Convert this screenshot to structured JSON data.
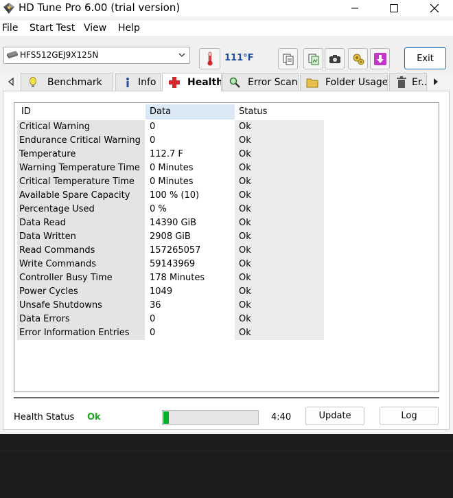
{
  "window": {
    "title": "HD Tune Pro 6.00 (trial version)",
    "controls": {
      "minimize": "minimize-icon",
      "maximize": "maximize-icon",
      "close": "close-icon"
    }
  },
  "menu": [
    "File",
    "Start Test",
    "View",
    "Help"
  ],
  "toolbar": {
    "drive": "HFS512GEJ9X125N",
    "temperature": "111°F",
    "icons": [
      "thermometer-icon",
      "copy-info-icon",
      "copy-screenshot-icon",
      "camera-icon",
      "options-icon",
      "save-icon"
    ],
    "exit_label": "Exit"
  },
  "tabs": [
    {
      "label": "Benchmark",
      "icon": "benchmark-icon"
    },
    {
      "label": "Info",
      "icon": "info-icon"
    },
    {
      "label": "Health",
      "icon": "health-icon",
      "active": true
    },
    {
      "label": "Error Scan",
      "icon": "error-scan-icon"
    },
    {
      "label": "Folder Usage",
      "icon": "folder-usage-icon"
    },
    {
      "label": "Er...",
      "icon": "erase-icon"
    }
  ],
  "table": {
    "columns": [
      "ID",
      "Data",
      "Status"
    ],
    "rows": [
      {
        "id": "Critical Warning",
        "data": "0",
        "status": "Ok"
      },
      {
        "id": "Endurance Critical Warning",
        "data": "0",
        "status": "Ok"
      },
      {
        "id": "Temperature",
        "data": "112.7 F",
        "status": "Ok"
      },
      {
        "id": "Warning Temperature Time",
        "data": "0 Minutes",
        "status": "Ok"
      },
      {
        "id": "Critical Temperature Time",
        "data": "0 Minutes",
        "status": "Ok"
      },
      {
        "id": "Available Spare Capacity",
        "data": "100 % (10)",
        "status": "Ok"
      },
      {
        "id": "Percentage Used",
        "data": "0 %",
        "status": "Ok"
      },
      {
        "id": "Data Read",
        "data": "14390 GiB",
        "status": "Ok"
      },
      {
        "id": "Data Written",
        "data": "2908 GiB",
        "status": "Ok"
      },
      {
        "id": "Read Commands",
        "data": "157265057",
        "status": "Ok"
      },
      {
        "id": "Write Commands",
        "data": "59143969",
        "status": "Ok"
      },
      {
        "id": "Controller Busy Time",
        "data": "178 Minutes",
        "status": "Ok"
      },
      {
        "id": "Power Cycles",
        "data": "1049",
        "status": "Ok"
      },
      {
        "id": "Unsafe Shutdowns",
        "data": "36",
        "status": "Ok"
      },
      {
        "id": "Data Errors",
        "data": "0",
        "status": "Ok"
      },
      {
        "id": "Error Information Entries",
        "data": "0",
        "status": "Ok"
      }
    ]
  },
  "footer": {
    "health_label": "Health Status",
    "health_value": "Ok",
    "progress_fraction": 0.06,
    "progress_color": "#06b025",
    "time": "4:40",
    "update_label": "Update",
    "log_label": "Log"
  },
  "colors": {
    "accent": "#0f6cbd",
    "ok_text": "#21a321",
    "temperature_text": "#1f4fa0"
  }
}
